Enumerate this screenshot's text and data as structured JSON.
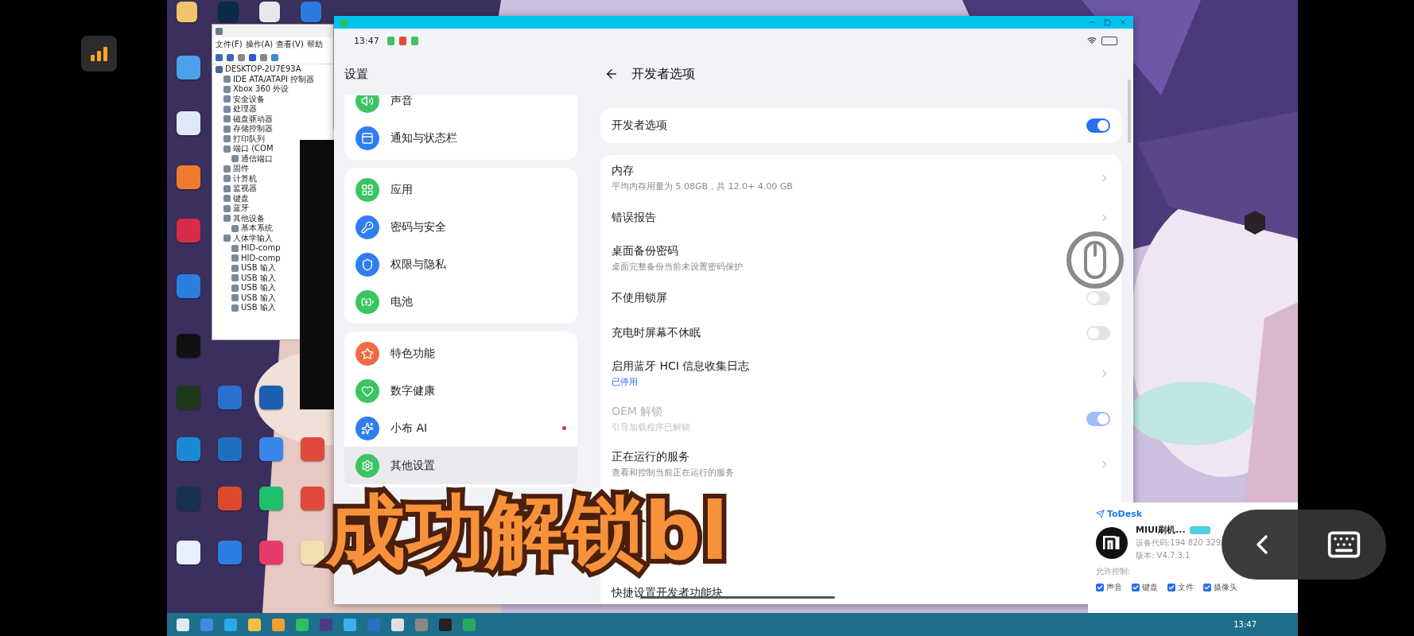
{
  "device_manager": {
    "menu": [
      "文件(F)",
      "操作(A)",
      "查看(V)",
      "帮助"
    ],
    "tree": [
      {
        "label": "DESKTOP-2U7E93A",
        "children": [
          {
            "label": "IDE ATA/ATAPI 控制器"
          },
          {
            "label": "Xbox 360 外设"
          },
          {
            "label": "安全设备"
          },
          {
            "label": "处理器"
          },
          {
            "label": "磁盘驱动器"
          },
          {
            "label": "存储控制器"
          },
          {
            "label": "打印队列"
          },
          {
            "label": "端口 (COM",
            "children": [
              {
                "label": "通信端口"
              }
            ]
          },
          {
            "label": "固件"
          },
          {
            "label": "计算机"
          },
          {
            "label": "监视器"
          },
          {
            "label": "键盘"
          },
          {
            "label": "蓝牙"
          },
          {
            "label": "其他设备",
            "children": [
              {
                "label": "基本系统"
              }
            ]
          },
          {
            "label": "人体学输入",
            "children": [
              {
                "label": "HID-comp"
              },
              {
                "label": "HID-comp"
              },
              {
                "label": "USB 输入"
              },
              {
                "label": "USB 输入"
              },
              {
                "label": "USB 输入"
              },
              {
                "label": "USB 输入"
              },
              {
                "label": "USB 输入"
              }
            ]
          }
        ]
      }
    ]
  },
  "phone": {
    "status_time": "13:47",
    "settings": {
      "title": "设置",
      "groups": [
        [
          {
            "label": "声音",
            "color": "#3cc463",
            "selected": false,
            "dot": false
          },
          {
            "label": "通知与状态栏",
            "color": "#2f7ef0",
            "selected": false,
            "dot": false
          }
        ],
        [
          {
            "label": "应用",
            "color": "#3cc463",
            "selected": false,
            "dot": false
          },
          {
            "label": "密码与安全",
            "color": "#2f7ef0",
            "selected": false,
            "dot": false
          },
          {
            "label": "权限与隐私",
            "color": "#2f7ef0",
            "selected": false,
            "dot": false
          },
          {
            "label": "电池",
            "color": "#3cc463",
            "selected": false,
            "dot": false
          }
        ],
        [
          {
            "label": "特色功能",
            "color": "#f06a45",
            "selected": false,
            "dot": false
          },
          {
            "label": "数字健康",
            "color": "#3cc463",
            "selected": false,
            "dot": false
          },
          {
            "label": "小布 AI",
            "color": "#2f7ef0",
            "selected": false,
            "dot": true
          },
          {
            "label": "其他设置",
            "color": "#3cc463",
            "selected": true,
            "dot": false
          }
        ]
      ]
    },
    "developer": {
      "title": "开发者选项",
      "master": {
        "label": "开发者选项",
        "on": true
      },
      "rows": [
        {
          "kind": "link",
          "title": "内存",
          "subtitle": "平均内存用量为 5.08GB，共 12.0+ 4.00 GB",
          "status": false,
          "disabled": false
        },
        {
          "kind": "link",
          "title": "错误报告",
          "disabled": false
        },
        {
          "kind": "plain",
          "title": "桌面备份密码",
          "subtitle": "桌面完整备份当前未设置密码保护",
          "status": false,
          "disabled": false
        },
        {
          "kind": "switch",
          "title": "不使用锁屏",
          "on": false,
          "disabled": false
        },
        {
          "kind": "switch",
          "title": "充电时屏幕不休眠",
          "on": false,
          "disabled": false
        },
        {
          "kind": "link",
          "title": "启用蓝牙 HCI 信息收集日志",
          "subtitle": "已停用",
          "status": true,
          "disabled": false
        },
        {
          "kind": "switch",
          "title": "OEM 解锁",
          "subtitle": "引导加载程序已解锁",
          "status": false,
          "on": true,
          "disabled": true
        },
        {
          "kind": "link",
          "title": "正在运行的服务",
          "subtitle": "查看和控制当前正在运行的服务",
          "status": false,
          "disabled": false
        },
        {
          "kind": "covered"
        },
        {
          "kind": "covered"
        },
        {
          "kind": "plain",
          "title": "快捷设置开发者功能块",
          "disabled": false
        }
      ]
    }
  },
  "caption": "成功解锁bl",
  "todesk": {
    "brand": "ToDesk",
    "device": "MIUI刷机...",
    "code": "设备代码:194 820 329",
    "version": "版本: V4.7.3.1",
    "permissions_label": "允许控制:",
    "permissions": [
      {
        "label": "声音",
        "checked": true
      },
      {
        "label": "键盘",
        "checked": true
      },
      {
        "label": "文件",
        "checked": true
      },
      {
        "label": "摄像头",
        "checked": true
      }
    ]
  },
  "taskbar": {
    "time": "13:47"
  }
}
